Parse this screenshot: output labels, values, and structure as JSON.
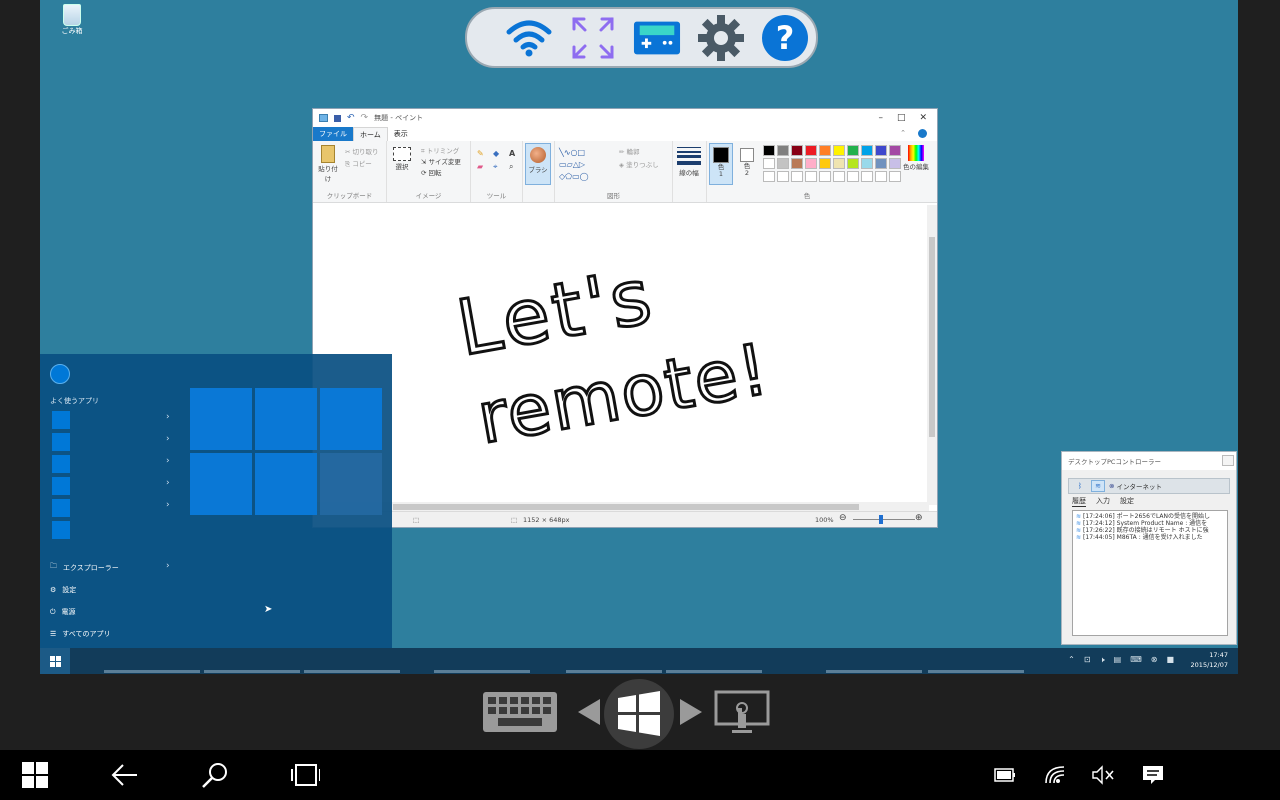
{
  "desktop": {
    "recycle_bin_label": "ごみ箱"
  },
  "top_controls": {
    "items": [
      "wifi-icon",
      "fullscreen-icon",
      "gamepad-icon",
      "gear-icon",
      "help-icon"
    ],
    "accent": "#0a74d6",
    "help_label": "?"
  },
  "paint": {
    "title": "無題 - ペイント",
    "tabs": {
      "file": "ファイル",
      "home": "ホーム",
      "view": "表示"
    },
    "ribbon": {
      "clipboard": {
        "paste": "貼り付け",
        "cut": "切り取り",
        "copy": "コピー",
        "group": "クリップボード"
      },
      "image": {
        "select": "選択",
        "crop": "トリミング",
        "resize": "サイズ変更",
        "rotate": "回転",
        "group": "イメージ"
      },
      "tools": {
        "group": "ツール"
      },
      "brush": {
        "label": "ブラシ"
      },
      "shapes": {
        "outline": "輪郭",
        "fill": "塗りつぶし",
        "group": "図形"
      },
      "size": {
        "label": "線の幅"
      },
      "color1": {
        "label": "色\n1"
      },
      "color2": {
        "label": "色\n2"
      },
      "edit_colors": "色の編集",
      "colors_group": "色"
    },
    "palette_row1": [
      "#000000",
      "#7f7f7f",
      "#880015",
      "#ed1c24",
      "#ff7f27",
      "#fff200",
      "#22b14c",
      "#00a2e8",
      "#3f48cc",
      "#a349a4"
    ],
    "palette_row2": [
      "#ffffff",
      "#c3c3c3",
      "#b97a57",
      "#ffaec9",
      "#ffc90e",
      "#efe4b0",
      "#b5e61d",
      "#99d9ea",
      "#7092be",
      "#c8bfe7"
    ],
    "canvas_text_line1": "Let's",
    "canvas_text_line2": "remote!",
    "status": {
      "size": "1152 × 648px",
      "zoom": "100%"
    }
  },
  "start_menu": {
    "most_used": "よく使うアプリ",
    "explorer": "エクスプローラー",
    "settings": "設定",
    "power": "電源",
    "all_apps": "すべてのアプリ"
  },
  "remote_taskbar": {
    "time": "17:47",
    "date": "2015/12/07"
  },
  "controller_window": {
    "title": "デスクトップPCコントローラー",
    "mode_internet": "インターネット",
    "tabs": [
      "履歴",
      "入力",
      "設定"
    ],
    "log": [
      {
        "time": "[17:24:06]",
        "text": "ポート2656でLANの受信を開始し"
      },
      {
        "time": "[17:24:12]",
        "text": "System Product Name : 通信を"
      },
      {
        "time": "[17:26:22]",
        "text": "既存の接続はリモート ホストに強"
      },
      {
        "time": "[17:44:05]",
        "text": "M86TA : 通信を受け入れました"
      }
    ]
  },
  "bottom_controls": {
    "items": [
      "keyboard-icon",
      "prev-arrow-icon",
      "windows-start-icon",
      "next-arrow-icon",
      "touch-screen-icon"
    ]
  },
  "local_taskbar": {
    "items": [
      "windows-icon",
      "back-icon",
      "search-icon",
      "task-view-icon",
      "battery-icon",
      "wifi-icon",
      "volume-mute-icon",
      "notification-icon"
    ]
  }
}
